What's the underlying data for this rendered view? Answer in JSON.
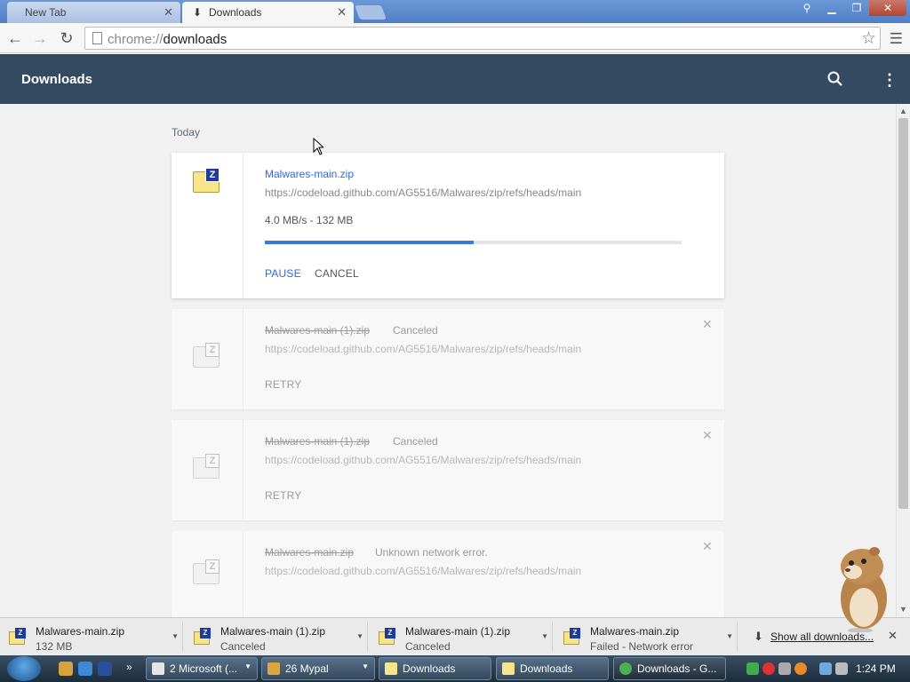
{
  "tabs": [
    {
      "label": "New Tab",
      "icon": "none"
    },
    {
      "label": "Downloads",
      "icon": "download-icon"
    }
  ],
  "omnibox": {
    "scheme": "chrome://",
    "path": "downloads"
  },
  "header": {
    "title": "Downloads"
  },
  "section": {
    "date_label": "Today"
  },
  "downloads": [
    {
      "file_name": "Malwares-main.zip",
      "url": "https://codeload.github.com/AG5516/Malwares/zip/refs/heads/main",
      "speed": "4.0 MB/s - 132 MB",
      "progress_fraction": 0.5,
      "actions": [
        "PAUSE",
        "CANCEL"
      ]
    },
    {
      "file_name": "Malwares-main (1).zip",
      "status": "Canceled",
      "url": "https://codeload.github.com/AG5516/Malwares/zip/refs/heads/main",
      "action": "RETRY"
    },
    {
      "file_name": "Malwares-main (1).zip",
      "status": "Canceled",
      "url": "https://codeload.github.com/AG5516/Malwares/zip/refs/heads/main",
      "action": "RETRY"
    },
    {
      "file_name": "Malwares-main.zip",
      "status": "Unknown network error.",
      "url": "https://codeload.github.com/AG5516/Malwares/zip/refs/heads/main"
    }
  ],
  "shelf": {
    "items": [
      {
        "name": "Malwares-main.zip",
        "status": "132 MB"
      },
      {
        "name": "Malwares-main (1).zip",
        "status": "Canceled"
      },
      {
        "name": "Malwares-main (1).zip",
        "status": "Canceled"
      },
      {
        "name": "Malwares-main.zip",
        "status": "Failed - Network error"
      }
    ],
    "show_all": "Show all downloads..."
  },
  "taskbar": {
    "tasks": [
      {
        "label": "2 Microsoft (...",
        "icon_color": "#e6e6e6"
      },
      {
        "label": "26 Mypal",
        "icon_color": "#d9a640"
      },
      {
        "label": "Downloads",
        "icon_color": "#f7e58a"
      },
      {
        "label": "Downloads",
        "icon_color": "#f7e58a"
      },
      {
        "label": "Downloads - G...",
        "icon_color": "#4caf50"
      }
    ],
    "clock": "1:24 PM"
  },
  "colors": {
    "header_bg": "#344a60",
    "link": "#3367d6",
    "progress": "#3c78d8"
  }
}
